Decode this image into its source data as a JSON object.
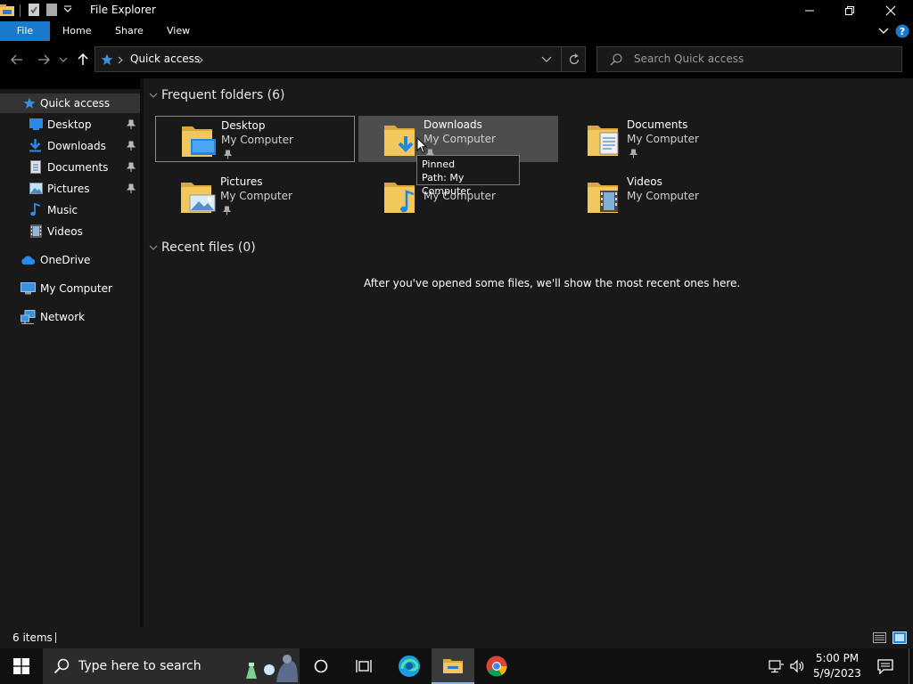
{
  "window": {
    "title": "File Explorer"
  },
  "ribbon": {
    "tabs": [
      "File",
      "Home",
      "Share",
      "View"
    ]
  },
  "address": {
    "crumb": "Quick access",
    "search_placeholder": "Search Quick access"
  },
  "navpane": {
    "items": [
      {
        "label": "Quick access",
        "icon": "star-icon",
        "selected": true
      },
      {
        "label": "Desktop",
        "icon": "desktop-icon",
        "pinned": true
      },
      {
        "label": "Downloads",
        "icon": "download-icon",
        "pinned": true
      },
      {
        "label": "Documents",
        "icon": "document-icon",
        "pinned": true
      },
      {
        "label": "Pictures",
        "icon": "pictures-icon",
        "pinned": true
      },
      {
        "label": "Music",
        "icon": "music-icon"
      },
      {
        "label": "Videos",
        "icon": "videos-icon"
      },
      {
        "label": "OneDrive",
        "icon": "cloud-icon"
      },
      {
        "label": "My Computer",
        "icon": "computer-icon"
      },
      {
        "label": "Network",
        "icon": "network-icon"
      }
    ]
  },
  "frequent": {
    "header": "Frequent folders (6)",
    "folders": [
      {
        "name": "Desktop",
        "path": "My Computer",
        "pinned": true
      },
      {
        "name": "Downloads",
        "path": "My Computer",
        "pinned": true
      },
      {
        "name": "Documents",
        "path": "My Computer",
        "pinned": true
      },
      {
        "name": "Pictures",
        "path": "My Computer",
        "pinned": true
      },
      {
        "name": "Music",
        "path": "My Computer",
        "pinned": false
      },
      {
        "name": "Videos",
        "path": "My Computer",
        "pinned": false
      }
    ]
  },
  "recent": {
    "header": "Recent files (0)",
    "empty_message": "After you've opened some files, we'll show the most recent ones here."
  },
  "tooltip": {
    "line1": "Pinned",
    "line2": "Path: My Computer"
  },
  "status": {
    "count": "6 items"
  },
  "taskbar": {
    "search_placeholder": "Type here to search",
    "time": "5:00 PM",
    "date": "5/9/2023"
  },
  "colors": {
    "accent": "#1979ca",
    "folder": "#f2c75c",
    "background": "#191919"
  }
}
